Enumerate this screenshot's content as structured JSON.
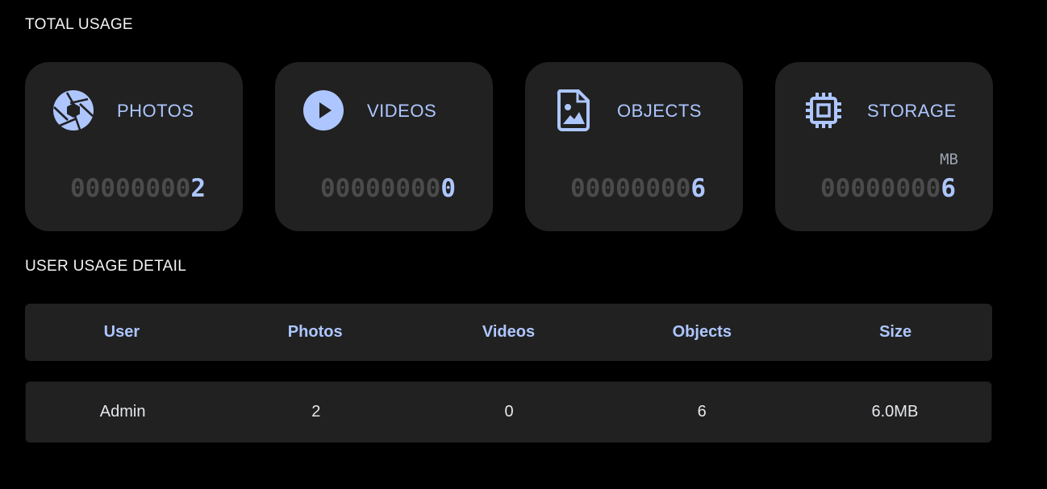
{
  "sections": {
    "total_title": "TOTAL USAGE",
    "detail_title": "USER USAGE DETAIL"
  },
  "cards": [
    {
      "label": "PHOTOS",
      "icon": "aperture-icon",
      "padding": "00000000",
      "value": "2",
      "unit": ""
    },
    {
      "label": "VIDEOS",
      "icon": "play-circle-icon",
      "padding": "00000000",
      "value": "0",
      "unit": ""
    },
    {
      "label": "OBJECTS",
      "icon": "image-file-icon",
      "padding": "00000000",
      "value": "6",
      "unit": ""
    },
    {
      "label": "STORAGE",
      "icon": "cpu-chip-icon",
      "padding": "00000000",
      "value": "6",
      "unit": "MB"
    }
  ],
  "table": {
    "columns": [
      "User",
      "Photos",
      "Videos",
      "Objects",
      "Size"
    ],
    "rows": [
      {
        "user": "Admin",
        "photos": "2",
        "videos": "0",
        "objects": "6",
        "size": "6.0MB"
      }
    ]
  },
  "colors": {
    "background": "#000000",
    "card": "#212121",
    "accent": "#adc6ff",
    "counter_padding": "#4b4b4b"
  }
}
